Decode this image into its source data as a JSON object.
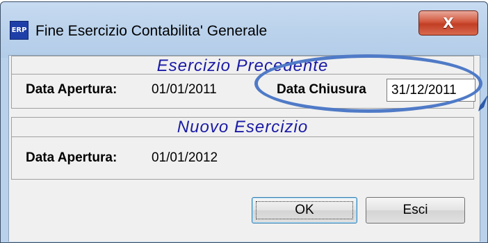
{
  "window": {
    "title": "Fine Esercizio Contabilita' Generale",
    "icon_text": "ERP",
    "close_glyph": "X"
  },
  "esercizio_precedente": {
    "header": "Esercizio Precedente",
    "data_apertura_label": "Data Apertura:",
    "data_apertura_value": "01/01/2011",
    "data_chiusura_label": "Data Chiusura",
    "data_chiusura_value": "31/12/2011"
  },
  "nuovo_esercizio": {
    "header": "Nuovo Esercizio",
    "data_apertura_label": "Data Apertura:",
    "data_apertura_value": "01/01/2012"
  },
  "buttons": {
    "ok_label": "OK",
    "esci_label": "Esci"
  },
  "colors": {
    "header_text": "#1a1aa6",
    "annotation": "#4f7ac7",
    "close_button": "#c13e24"
  }
}
